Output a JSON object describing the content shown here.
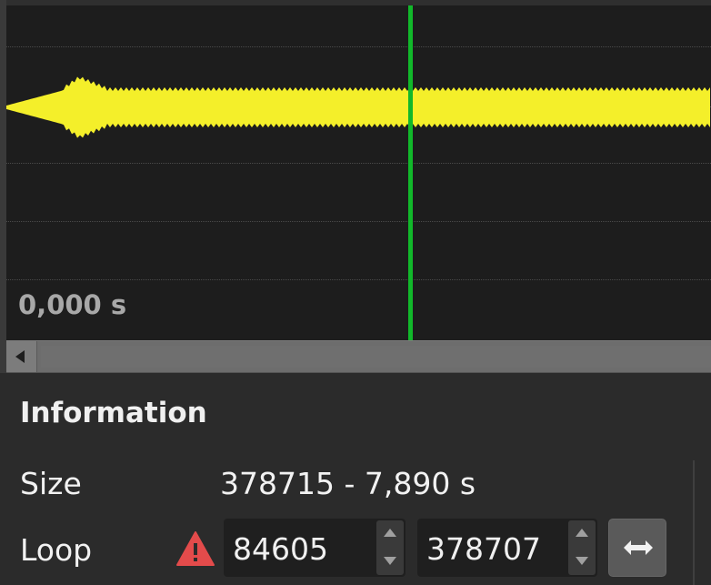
{
  "waveform": {
    "time_label": "0,000 s",
    "wave_color": "#f4ef2a",
    "playhead_color": "#11b82a"
  },
  "scrollbar": {
    "left_arrow_icon": "triangle-left-icon"
  },
  "information": {
    "title": "Information",
    "size_label": "Size",
    "size_value": "378715 - 7,890 s",
    "loop_label": "Loop",
    "warning_icon": "warning-triangle-icon",
    "warning_color": "#e34b4b",
    "loop_start": "84605",
    "loop_end": "378707",
    "swap_icon": "horizontal-double-arrow-icon"
  }
}
